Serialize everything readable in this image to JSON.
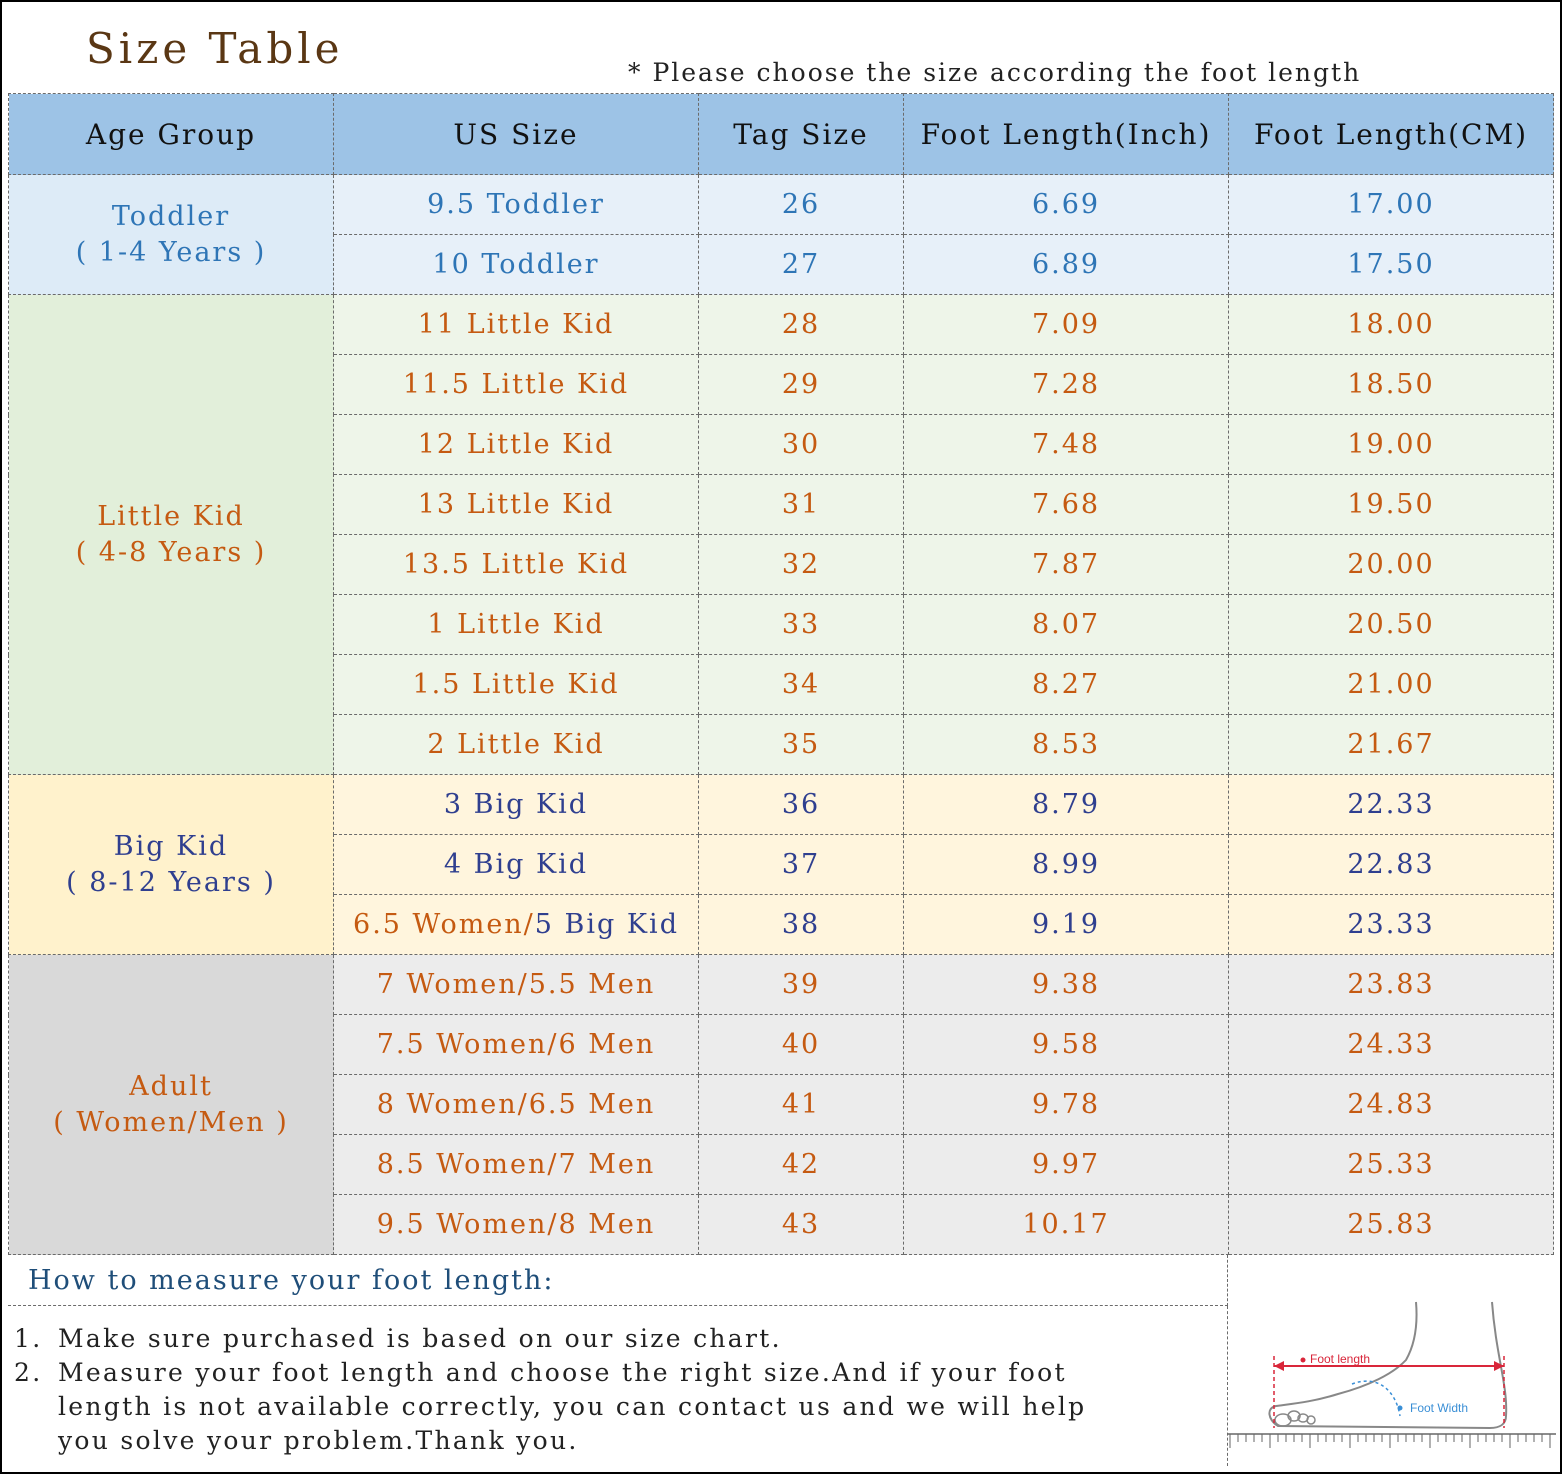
{
  "title": "Size Table",
  "note": "* Please choose the size according the foot length",
  "headers": [
    "Age Group",
    "US Size",
    "Tag Size",
    "Foot Length(Inch)",
    "Foot Length(CM)"
  ],
  "groups": [
    {
      "name": "Toddler",
      "range": "( 1-4 Years )",
      "color": "#2e75b6",
      "bg": "#ddebf7",
      "rowbg": "#e7f0f9"
    },
    {
      "name": "Little Kid",
      "range": "( 4-8 Years )",
      "color": "#c55a11",
      "bg": "#e2efda",
      "rowbg": "#eef5e9"
    },
    {
      "name": "Big Kid",
      "range": "( 8-12 Years )",
      "color": "#2f3f8f",
      "bg": "#fff2cc",
      "rowbg": "#fff5dd"
    },
    {
      "name": "Adult",
      "range": "( Women/Men )",
      "color": "#c55a11",
      "bg": "#d9d9d9",
      "rowbg": "#ececec"
    }
  ],
  "rows": [
    {
      "us": "9.5 Toddler",
      "tag": "26",
      "inch": "6.69",
      "cm": "17.00"
    },
    {
      "us": "10 Toddler",
      "tag": "27",
      "inch": "6.89",
      "cm": "17.50"
    },
    {
      "us": "11 Little Kid",
      "tag": "28",
      "inch": "7.09",
      "cm": "18.00"
    },
    {
      "us": "11.5 Little Kid",
      "tag": "29",
      "inch": "7.28",
      "cm": "18.50"
    },
    {
      "us": "12 Little Kid",
      "tag": "30",
      "inch": "7.48",
      "cm": "19.00"
    },
    {
      "us": "13 Little Kid",
      "tag": "31",
      "inch": "7.68",
      "cm": "19.50"
    },
    {
      "us": "13.5 Little Kid",
      "tag": "32",
      "inch": "7.87",
      "cm": "20.00"
    },
    {
      "us": "1 Little Kid",
      "tag": "33",
      "inch": "8.07",
      "cm": "20.50"
    },
    {
      "us": "1.5 Little Kid",
      "tag": "34",
      "inch": "8.27",
      "cm": "21.00"
    },
    {
      "us": "2 Little Kid",
      "tag": "35",
      "inch": "8.53",
      "cm": "21.67"
    },
    {
      "us": "3 Big Kid",
      "tag": "36",
      "inch": "8.79",
      "cm": "22.33"
    },
    {
      "us": "4 Big Kid",
      "tag": "37",
      "inch": "8.99",
      "cm": "22.83"
    },
    {
      "us_a": "6.5 Women/",
      "us_b": "5 Big Kid",
      "tag": "38",
      "inch": "9.19",
      "cm": "23.33"
    },
    {
      "us": "7 Women/5.5 Men",
      "tag": "39",
      "inch": "9.38",
      "cm": "23.83"
    },
    {
      "us": "7.5 Women/6 Men",
      "tag": "40",
      "inch": "9.58",
      "cm": "24.33"
    },
    {
      "us": "8 Women/6.5 Men",
      "tag": "41",
      "inch": "9.78",
      "cm": "24.83"
    },
    {
      "us": "8.5 Women/7 Men",
      "tag": "42",
      "inch": "9.97",
      "cm": "25.33"
    },
    {
      "us": "9.5 Women/8 Men",
      "tag": "43",
      "inch": "10.17",
      "cm": "25.83"
    }
  ],
  "howto": {
    "heading": "How to measure your foot length:",
    "step1_num": "1.",
    "step1": "Make sure purchased is based on our size chart.",
    "step2_num": "2.",
    "step2_line1": "Measure your foot length and choose the right size.And if your foot",
    "step2_line2": "length is not available correctly, you can contact us and we will help",
    "step2_line3": "you solve your problem.Thank you."
  },
  "diagram": {
    "foot_length_label": "Foot length",
    "foot_width_label": "Foot Width",
    "accent": "#d9263a",
    "width_accent": "#3a8fd6"
  }
}
